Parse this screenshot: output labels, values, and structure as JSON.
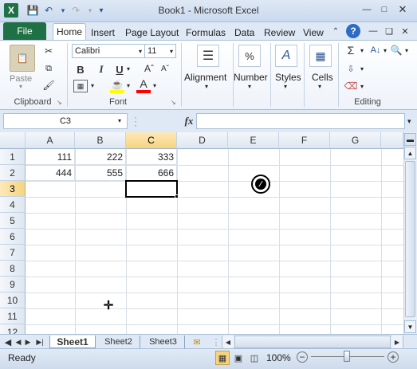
{
  "window": {
    "title": "Book1 - Microsoft Excel"
  },
  "qat": {
    "save_icon": "save-icon",
    "undo_icon": "undo-icon",
    "redo_icon": "redo-icon",
    "customize_icon": "customize-icon"
  },
  "tabs": {
    "file": "File",
    "items": [
      "Home",
      "Insert",
      "Page Layout",
      "Formulas",
      "Data",
      "Review",
      "View"
    ]
  },
  "ribbon": {
    "clipboard": {
      "paste": "Paste",
      "label": "Clipboard"
    },
    "font": {
      "name": "Calibri",
      "size": "11",
      "bold": "B",
      "italic": "I",
      "underline": "U",
      "color_letter": "A",
      "label": "Font",
      "fill_color": "#ffff00",
      "font_color": "#ff0000"
    },
    "alignment": {
      "label": "Alignment"
    },
    "number": {
      "symbol": "%",
      "label": "Number"
    },
    "styles": {
      "label": "Styles"
    },
    "cells": {
      "label": "Cells"
    },
    "editing": {
      "sum": "Σ",
      "label": "Editing"
    }
  },
  "formula_bar": {
    "name_box": "C3",
    "fx": "fx",
    "value": ""
  },
  "grid": {
    "columns": [
      "A",
      "B",
      "C",
      "D",
      "E",
      "F",
      "G"
    ],
    "rows": [
      "1",
      "2",
      "3",
      "4",
      "5",
      "6",
      "7",
      "8",
      "9",
      "10",
      "11",
      "12"
    ],
    "cells": [
      [
        "111",
        "222",
        "333",
        "",
        "",
        "",
        ""
      ],
      [
        "444",
        "555",
        "666",
        "",
        "",
        "",
        ""
      ]
    ],
    "active_cell": "C3"
  },
  "sheets": [
    "Sheet1",
    "Sheet2",
    "Sheet3"
  ],
  "status": {
    "state": "Ready",
    "zoom": "100%"
  }
}
